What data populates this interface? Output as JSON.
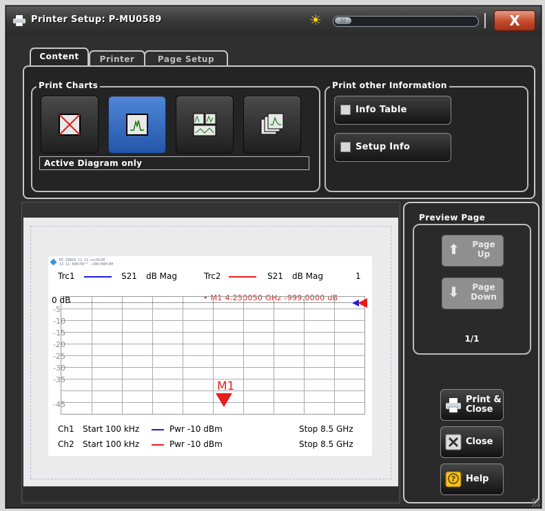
{
  "window": {
    "title": "Printer Setup: P-MU0589",
    "close_label": "X",
    "brightness_thumb": "|||"
  },
  "tabs": [
    {
      "label": "Content",
      "active": true
    },
    {
      "label": "Printer",
      "active": false
    },
    {
      "label": "Page Setup",
      "active": false
    }
  ],
  "print_charts": {
    "label": "Print Charts",
    "options": [
      {
        "icon": "no-chart-icon",
        "selected": false
      },
      {
        "icon": "single-diagram-icon",
        "selected": true
      },
      {
        "icon": "all-diagrams-icon",
        "selected": false
      },
      {
        "icon": "stacked-diagrams-icon",
        "selected": false
      }
    ],
    "status": "Active Diagram only"
  },
  "print_other": {
    "label": "Print other Information",
    "info_table": "Info Table",
    "setup_info": "Setup Info"
  },
  "preview": {
    "logo_lines": [
      "RS.ZVB20 11 11.xx/8x30",
      "13 11 4DE+50°° -100/00P+0H"
    ],
    "trc1": {
      "name": "Trc1",
      "param": "S21",
      "format": "dB Mag",
      "color": "#1a1adc"
    },
    "trc2": {
      "name": "Trc2",
      "param": "S21",
      "format": "dB Mag",
      "color": "#e81c1c",
      "number": "1"
    },
    "marker_readout": "• M1   4.250050   GHz   -999.0000  dB",
    "marker_label": "M1",
    "y_labels": [
      "0 dB",
      "-5",
      "-10",
      "-15",
      "-20",
      "-25",
      "-30",
      "-35",
      "-45"
    ],
    "ch1": {
      "label": "Ch1",
      "start": "Start  100 kHz",
      "pwr": "Pwr  -10 dBm",
      "stop": "Stop  8.5 GHz"
    },
    "ch2": {
      "label": "Ch2",
      "start": "Start  100 kHz",
      "pwr": "Pwr  -10 dBm",
      "stop": "Stop  8.5 GHz"
    }
  },
  "preview_page": {
    "label": "Preview Page",
    "page_up": [
      "Page",
      "Up"
    ],
    "page_down": [
      "Page",
      "Down"
    ],
    "page_count": "1/1"
  },
  "actions": {
    "print_close": [
      "Print &",
      "Close"
    ],
    "close": "Close",
    "help": "Help"
  }
}
